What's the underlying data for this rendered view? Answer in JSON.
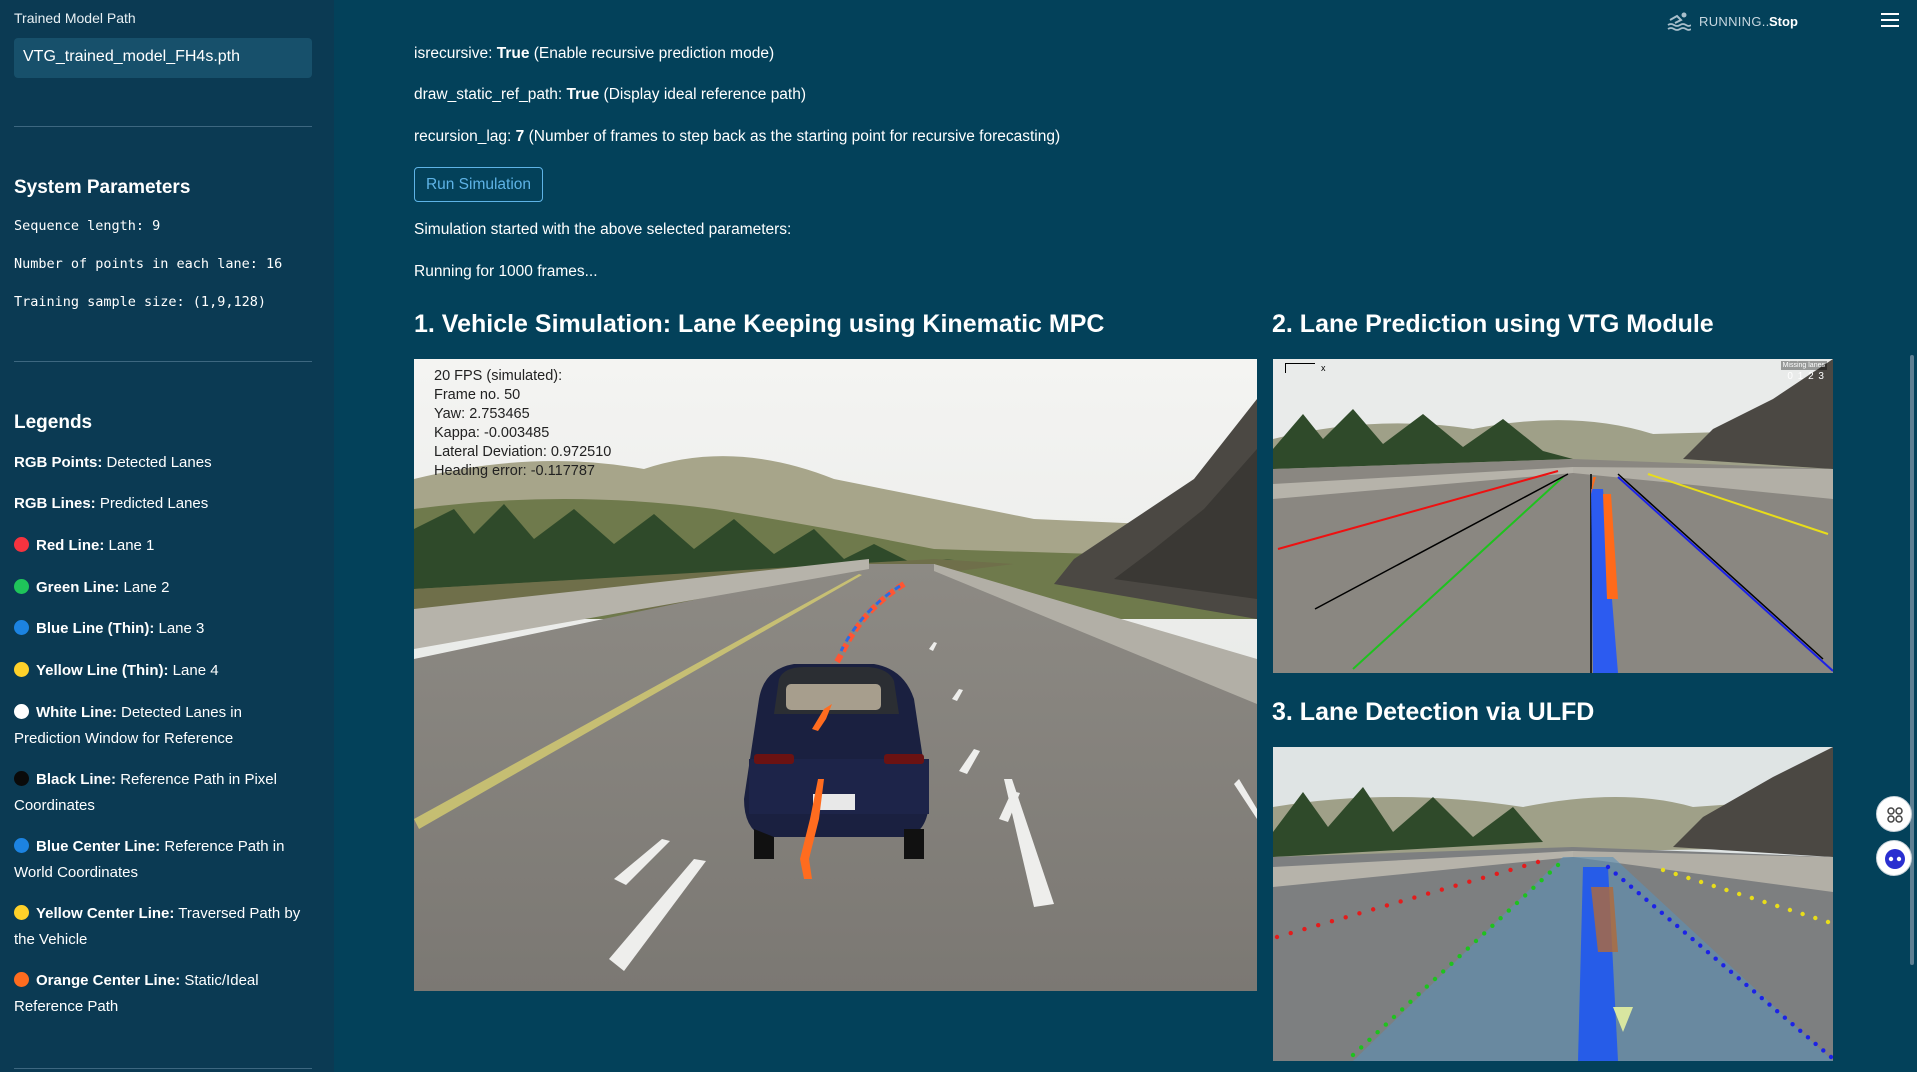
{
  "sidebar": {
    "model_path_label": "Trained Model Path",
    "model_path_value": "VTG_trained_model_FH4s.pth",
    "system_params_title": "System Parameters",
    "params": [
      "Sequence length: 9",
      "Number of points in each lane: 16",
      "Training sample size: (1,9,128)"
    ],
    "legends_title": "Legends",
    "legends": [
      {
        "bold": "RGB Points:",
        "text": " Detected Lanes",
        "color": ""
      },
      {
        "bold": "RGB Lines:",
        "text": " Predicted Lanes",
        "color": ""
      },
      {
        "bold": "Red Line:",
        "text": " Lane 1",
        "color": "#f5333f"
      },
      {
        "bold": "Green Line:",
        "text": " Lane 2",
        "color": "#1fc45a"
      },
      {
        "bold": "Blue Line (Thin):",
        "text": " Lane 3",
        "color": "#1c83e1"
      },
      {
        "bold": "Yellow Line (Thin):",
        "text": " Lane 4",
        "color": "#ffd12a"
      },
      {
        "bold": "White Line:",
        "text": " Detected Lanes in Prediction Window for Reference",
        "color": "#ffffff"
      },
      {
        "bold": "Black Line:",
        "text": " Reference Path in Pixel Coordinates",
        "color": "#0a0a0a"
      },
      {
        "bold": "Blue Center Line:",
        "text": " Reference Path in World Coordinates",
        "color": "#1c83e1"
      },
      {
        "bold": "Yellow Center Line:",
        "text": " Traversed Path by the Vehicle",
        "color": "#ffd12a"
      },
      {
        "bold": "Orange Center Line:",
        "text": " Static/Ideal Reference Path",
        "color": "#ff6c1f"
      }
    ]
  },
  "topbar": {
    "status": "RUNNING...",
    "stop_label": "Stop",
    "menu_icon": "hamburger-menu-icon",
    "running_icon": "swimmer-icon"
  },
  "main": {
    "params": [
      {
        "key": "isrecursive:",
        "value": "True",
        "desc": " (Enable recursive prediction mode)"
      },
      {
        "key": "draw_static_ref_path:",
        "value": "True",
        "desc": " (Display ideal reference path)"
      },
      {
        "key": "recursion_lag:",
        "value": "7",
        "desc": " (Number of frames to step back as the starting point for recursive forecasting)"
      }
    ],
    "run_button_label": "Run Simulation",
    "status_started": "Simulation started with the above selected parameters:",
    "status_frames": "Running for 1000 frames...",
    "section1_title": "1. Vehicle Simulation: Lane Keeping using Kinematic MPC",
    "section2_title": "2. Lane Prediction using VTG Module",
    "section3_title": "3. Lane Detection via ULFD",
    "sim_overlay": [
      "20 FPS (simulated):",
      "Frame no. 50",
      "Yaw: 2.753465",
      "Kappa: -0.003485",
      "Lateral Deviation: 0.972510",
      "Heading error: -0.117787"
    ],
    "vtg_missing_label": "Missing lanes",
    "vtg_missing_indices": "0 1 2 3",
    "vtg_axis_label": "x",
    "accent": "#5eb3e6"
  }
}
